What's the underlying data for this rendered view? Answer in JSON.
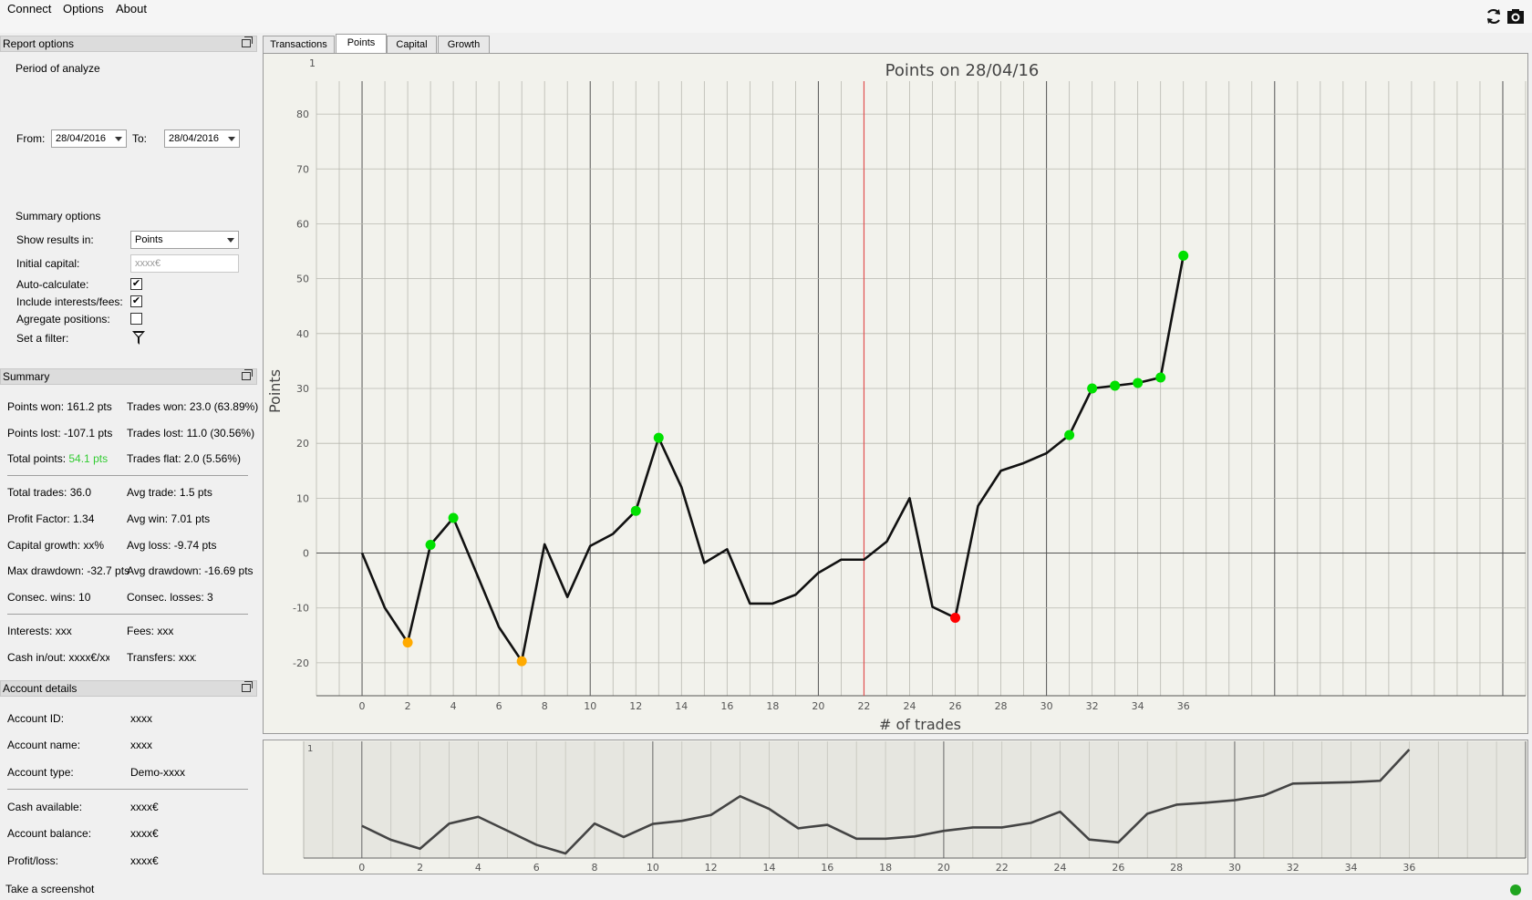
{
  "menu": {
    "connect": "Connect",
    "options": "Options",
    "about": "About"
  },
  "toolbar": {
    "refresh_icon": "refresh-icon",
    "camera_icon": "camera-icon"
  },
  "report_options": {
    "header": "Report options",
    "period_title": "Period of analyze",
    "from_label": "From:",
    "from_value": "28/04/2016",
    "to_label": "To:",
    "to_value": "28/04/2016",
    "summary_options_title": "Summary options",
    "show_results_label": "Show results in:",
    "show_results_value": "Points",
    "initial_capital_label": "Initial capital:",
    "initial_capital_placeholder": "xxxx€",
    "auto_calc_label": "Auto-calculate:",
    "auto_calc_checked": true,
    "include_fees_label": "Include interests/fees:",
    "include_fees_checked": true,
    "aggregate_label": "Agregate positions:",
    "aggregate_checked": false,
    "filter_label": "Set a filter:"
  },
  "summary": {
    "header": "Summary",
    "points_won": "Points won: 161.2 pts",
    "trades_won": "Trades won: 23.0 (63.89%)",
    "points_lost": "Points lost: -107.1 pts",
    "trades_lost": "Trades lost: 11.0 (30.56%)",
    "total_points_label": "Total points: ",
    "total_points_value": "54.1 pts",
    "trades_flat": "Trades flat: 2.0 (5.56%)",
    "total_trades": "Total trades: 36.0",
    "avg_trade": "Avg trade: 1.5 pts",
    "profit_factor": "Profit Factor: 1.34",
    "avg_win": "Avg win: 7.01 pts",
    "capital_growth": "Capital growth: xx%",
    "avg_loss": "Avg loss: -9.74 pts",
    "max_drawdown": "Max drawdown: -32.7 pts",
    "avg_drawdown": "Avg drawdown: -16.69 pts",
    "consec_wins": "Consec. wins: 10",
    "consec_losses": "Consec. losses: 3",
    "interests": "Interests: xxx",
    "fees": "Fees: xxx",
    "cash_inout": "Cash in/out: xxxx€/xxx",
    "transfers": "Transfers: xxxx"
  },
  "account": {
    "header": "Account details",
    "id_label": "Account ID:",
    "id_value": "xxxx",
    "name_label": "Account name:",
    "name_value": "xxxx",
    "type_label": "Account type:",
    "type_value": "Demo-xxxx",
    "cash_label": "Cash available:",
    "cash_value": "xxxx€",
    "balance_label": "Account balance:",
    "balance_value": "xxxx€",
    "pl_label": "Profit/loss:",
    "pl_value": "xxxx€"
  },
  "tabs": [
    "Transactions",
    "Points",
    "Capital",
    "Growth"
  ],
  "active_tab": "Points",
  "status": {
    "text": "Take a screenshot"
  },
  "colors": {
    "positive": "#33cc33",
    "highlight_green": "#00e000",
    "highlight_orange": "#ffaa00",
    "highlight_red": "#ff0000",
    "cursor_line": "#e05050"
  },
  "chart_data": {
    "type": "line",
    "title": "Points on 28/04/16",
    "xlabel": "# of trades",
    "ylabel": "Points",
    "corner_label": "1",
    "xlim": [
      -2,
      51
    ],
    "ylim": [
      -26,
      86
    ],
    "xticks": [
      0,
      2,
      4,
      6,
      8,
      10,
      12,
      14,
      16,
      18,
      20,
      22,
      24,
      26,
      28,
      30,
      32,
      34,
      36
    ],
    "yticks": [
      -20,
      -10,
      0,
      10,
      20,
      30,
      40,
      50,
      60,
      70,
      80
    ],
    "cursor_x": 22,
    "x": [
      0,
      1,
      2,
      3,
      4,
      5,
      6,
      7,
      8,
      9,
      10,
      11,
      12,
      13,
      14,
      15,
      16,
      17,
      18,
      19,
      20,
      21,
      22,
      23,
      24,
      25,
      26,
      27,
      28,
      29,
      30,
      31,
      32,
      33,
      34,
      35,
      36
    ],
    "y": [
      0,
      -10,
      -16.3,
      1.5,
      6.4,
      -3.5,
      -13.5,
      -19.7,
      1.6,
      -8,
      1.3,
      3.5,
      7.7,
      21,
      12,
      -1.8,
      0.7,
      -9.2,
      -9.2,
      -7.6,
      -3.6,
      -1.2,
      -1.2,
      2.1,
      10,
      -9.8,
      -11.8,
      8.6,
      15,
      16.4,
      18.2,
      21.5,
      30,
      30.5,
      31,
      32,
      54.2
    ],
    "markers": [
      {
        "x": 2,
        "color": "orange"
      },
      {
        "x": 3,
        "color": "green"
      },
      {
        "x": 4,
        "color": "green"
      },
      {
        "x": 7,
        "color": "orange"
      },
      {
        "x": 12,
        "color": "green"
      },
      {
        "x": 13,
        "color": "green"
      },
      {
        "x": 26,
        "color": "red"
      },
      {
        "x": 31,
        "color": "green"
      },
      {
        "x": 32,
        "color": "green"
      },
      {
        "x": 33,
        "color": "green"
      },
      {
        "x": 34,
        "color": "green"
      },
      {
        "x": 35,
        "color": "green"
      },
      {
        "x": 36,
        "color": "green"
      }
    ],
    "overview": {
      "corner_label": "1",
      "xticks": [
        0,
        2,
        4,
        6,
        8,
        10,
        12,
        14,
        16,
        18,
        20,
        22,
        24,
        26,
        28,
        30,
        32,
        34,
        36
      ],
      "xlim": [
        -2,
        40
      ]
    }
  }
}
